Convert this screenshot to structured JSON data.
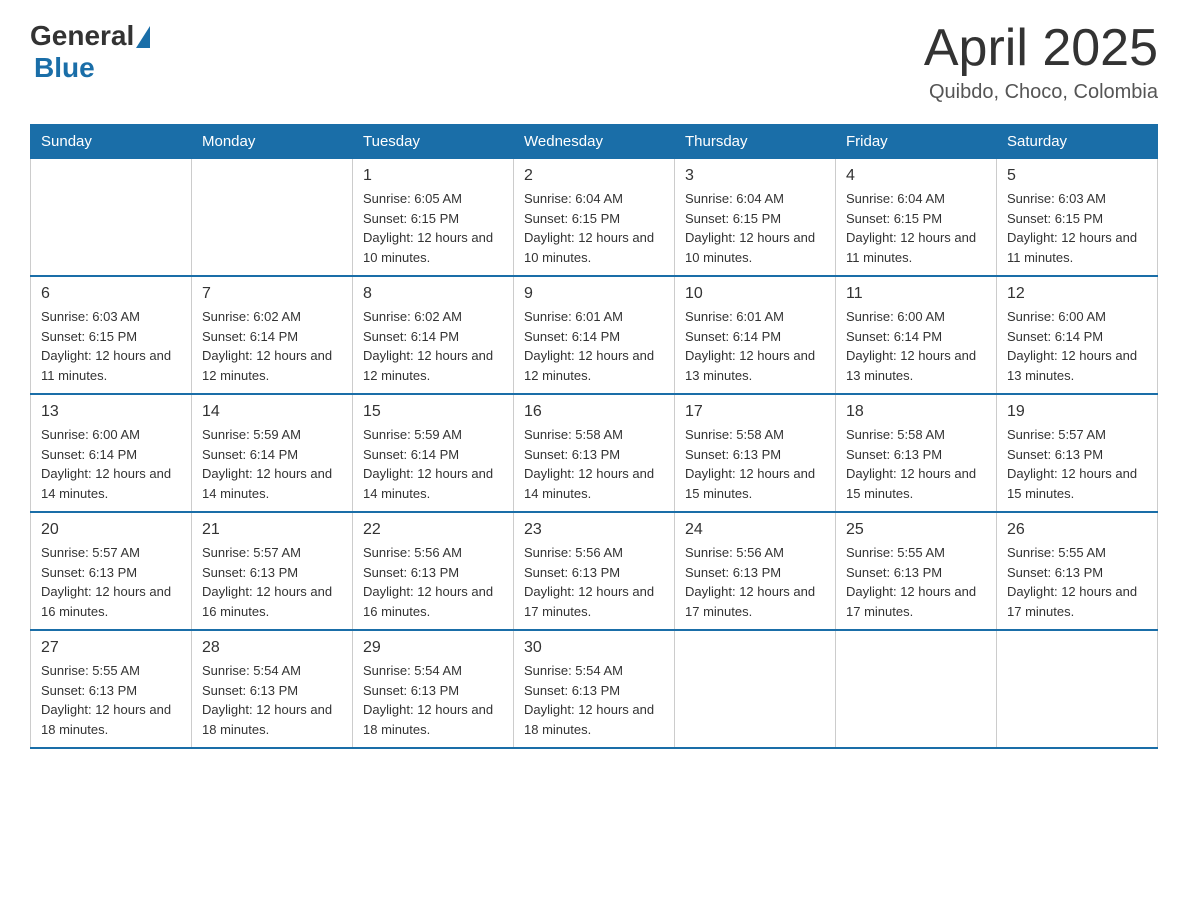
{
  "logo": {
    "general": "General",
    "blue": "Blue"
  },
  "title": "April 2025",
  "location": "Quibdo, Choco, Colombia",
  "days_of_week": [
    "Sunday",
    "Monday",
    "Tuesday",
    "Wednesday",
    "Thursday",
    "Friday",
    "Saturday"
  ],
  "weeks": [
    [
      {
        "day": "",
        "sunrise": "",
        "sunset": "",
        "daylight": ""
      },
      {
        "day": "",
        "sunrise": "",
        "sunset": "",
        "daylight": ""
      },
      {
        "day": "1",
        "sunrise": "Sunrise: 6:05 AM",
        "sunset": "Sunset: 6:15 PM",
        "daylight": "Daylight: 12 hours and 10 minutes."
      },
      {
        "day": "2",
        "sunrise": "Sunrise: 6:04 AM",
        "sunset": "Sunset: 6:15 PM",
        "daylight": "Daylight: 12 hours and 10 minutes."
      },
      {
        "day": "3",
        "sunrise": "Sunrise: 6:04 AM",
        "sunset": "Sunset: 6:15 PM",
        "daylight": "Daylight: 12 hours and 10 minutes."
      },
      {
        "day": "4",
        "sunrise": "Sunrise: 6:04 AM",
        "sunset": "Sunset: 6:15 PM",
        "daylight": "Daylight: 12 hours and 11 minutes."
      },
      {
        "day": "5",
        "sunrise": "Sunrise: 6:03 AM",
        "sunset": "Sunset: 6:15 PM",
        "daylight": "Daylight: 12 hours and 11 minutes."
      }
    ],
    [
      {
        "day": "6",
        "sunrise": "Sunrise: 6:03 AM",
        "sunset": "Sunset: 6:15 PM",
        "daylight": "Daylight: 12 hours and 11 minutes."
      },
      {
        "day": "7",
        "sunrise": "Sunrise: 6:02 AM",
        "sunset": "Sunset: 6:14 PM",
        "daylight": "Daylight: 12 hours and 12 minutes."
      },
      {
        "day": "8",
        "sunrise": "Sunrise: 6:02 AM",
        "sunset": "Sunset: 6:14 PM",
        "daylight": "Daylight: 12 hours and 12 minutes."
      },
      {
        "day": "9",
        "sunrise": "Sunrise: 6:01 AM",
        "sunset": "Sunset: 6:14 PM",
        "daylight": "Daylight: 12 hours and 12 minutes."
      },
      {
        "day": "10",
        "sunrise": "Sunrise: 6:01 AM",
        "sunset": "Sunset: 6:14 PM",
        "daylight": "Daylight: 12 hours and 13 minutes."
      },
      {
        "day": "11",
        "sunrise": "Sunrise: 6:00 AM",
        "sunset": "Sunset: 6:14 PM",
        "daylight": "Daylight: 12 hours and 13 minutes."
      },
      {
        "day": "12",
        "sunrise": "Sunrise: 6:00 AM",
        "sunset": "Sunset: 6:14 PM",
        "daylight": "Daylight: 12 hours and 13 minutes."
      }
    ],
    [
      {
        "day": "13",
        "sunrise": "Sunrise: 6:00 AM",
        "sunset": "Sunset: 6:14 PM",
        "daylight": "Daylight: 12 hours and 14 minutes."
      },
      {
        "day": "14",
        "sunrise": "Sunrise: 5:59 AM",
        "sunset": "Sunset: 6:14 PM",
        "daylight": "Daylight: 12 hours and 14 minutes."
      },
      {
        "day": "15",
        "sunrise": "Sunrise: 5:59 AM",
        "sunset": "Sunset: 6:14 PM",
        "daylight": "Daylight: 12 hours and 14 minutes."
      },
      {
        "day": "16",
        "sunrise": "Sunrise: 5:58 AM",
        "sunset": "Sunset: 6:13 PM",
        "daylight": "Daylight: 12 hours and 14 minutes."
      },
      {
        "day": "17",
        "sunrise": "Sunrise: 5:58 AM",
        "sunset": "Sunset: 6:13 PM",
        "daylight": "Daylight: 12 hours and 15 minutes."
      },
      {
        "day": "18",
        "sunrise": "Sunrise: 5:58 AM",
        "sunset": "Sunset: 6:13 PM",
        "daylight": "Daylight: 12 hours and 15 minutes."
      },
      {
        "day": "19",
        "sunrise": "Sunrise: 5:57 AM",
        "sunset": "Sunset: 6:13 PM",
        "daylight": "Daylight: 12 hours and 15 minutes."
      }
    ],
    [
      {
        "day": "20",
        "sunrise": "Sunrise: 5:57 AM",
        "sunset": "Sunset: 6:13 PM",
        "daylight": "Daylight: 12 hours and 16 minutes."
      },
      {
        "day": "21",
        "sunrise": "Sunrise: 5:57 AM",
        "sunset": "Sunset: 6:13 PM",
        "daylight": "Daylight: 12 hours and 16 minutes."
      },
      {
        "day": "22",
        "sunrise": "Sunrise: 5:56 AM",
        "sunset": "Sunset: 6:13 PM",
        "daylight": "Daylight: 12 hours and 16 minutes."
      },
      {
        "day": "23",
        "sunrise": "Sunrise: 5:56 AM",
        "sunset": "Sunset: 6:13 PM",
        "daylight": "Daylight: 12 hours and 17 minutes."
      },
      {
        "day": "24",
        "sunrise": "Sunrise: 5:56 AM",
        "sunset": "Sunset: 6:13 PM",
        "daylight": "Daylight: 12 hours and 17 minutes."
      },
      {
        "day": "25",
        "sunrise": "Sunrise: 5:55 AM",
        "sunset": "Sunset: 6:13 PM",
        "daylight": "Daylight: 12 hours and 17 minutes."
      },
      {
        "day": "26",
        "sunrise": "Sunrise: 5:55 AM",
        "sunset": "Sunset: 6:13 PM",
        "daylight": "Daylight: 12 hours and 17 minutes."
      }
    ],
    [
      {
        "day": "27",
        "sunrise": "Sunrise: 5:55 AM",
        "sunset": "Sunset: 6:13 PM",
        "daylight": "Daylight: 12 hours and 18 minutes."
      },
      {
        "day": "28",
        "sunrise": "Sunrise: 5:54 AM",
        "sunset": "Sunset: 6:13 PM",
        "daylight": "Daylight: 12 hours and 18 minutes."
      },
      {
        "day": "29",
        "sunrise": "Sunrise: 5:54 AM",
        "sunset": "Sunset: 6:13 PM",
        "daylight": "Daylight: 12 hours and 18 minutes."
      },
      {
        "day": "30",
        "sunrise": "Sunrise: 5:54 AM",
        "sunset": "Sunset: 6:13 PM",
        "daylight": "Daylight: 12 hours and 18 minutes."
      },
      {
        "day": "",
        "sunrise": "",
        "sunset": "",
        "daylight": ""
      },
      {
        "day": "",
        "sunrise": "",
        "sunset": "",
        "daylight": ""
      },
      {
        "day": "",
        "sunrise": "",
        "sunset": "",
        "daylight": ""
      }
    ]
  ]
}
